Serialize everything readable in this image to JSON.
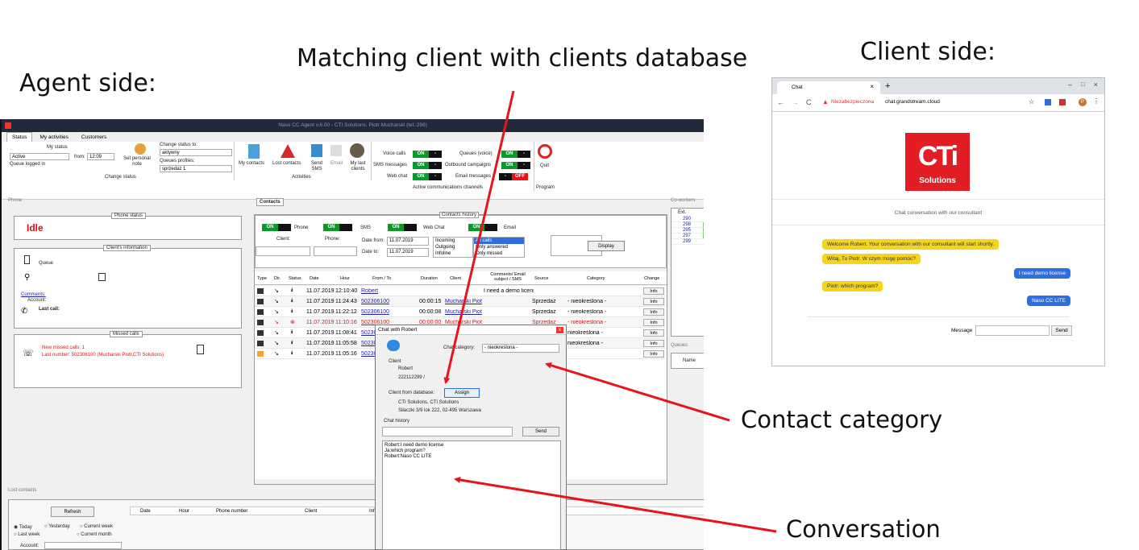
{
  "slide": {
    "agent_side": "Agent side:",
    "client_side": "Client side:",
    "matching": "Matching client with clients database",
    "contact_category": "Contact category",
    "conversation": "Conversation"
  },
  "agent_app": {
    "title": "Naso CC Agent v.6.00 - CTI Solutions, Piotr Mucharski (tel.:298)",
    "tabs": [
      "Status",
      "My activities",
      "Customers"
    ],
    "my_status_label": "My status",
    "status_value": "Active",
    "from_label": "from:",
    "from_value": "12:09",
    "queue_logged": "Queue logged in",
    "set_personal_note": "Set personal note",
    "change_status_to": "Change status to:",
    "status_select": "aktywny",
    "queues_profiles": "Queues profiles:",
    "profile_select": "sprzedaz 1",
    "change_status_group": "Change status",
    "activities": [
      "My contacts",
      "Lost contacts",
      "Send SMS",
      "Email",
      "My last clients"
    ],
    "activities_group": "Activities",
    "channels": [
      {
        "label": "Voice calls",
        "state": "ON"
      },
      {
        "label": "SMS messages",
        "state": "ON"
      },
      {
        "label": "Web chat",
        "state": "ON"
      },
      {
        "label": "Queues (voice)",
        "state": "ON"
      },
      {
        "label": "Outbound campaigns",
        "state": "ON"
      },
      {
        "label": "Email messages",
        "state": "OFF"
      }
    ],
    "on_label": "ON",
    "off_label": "OFF",
    "channels_group": "Active communications channels",
    "quit": "Quit",
    "program_group": "Program",
    "phone_panel": "Phone",
    "phone_status": "Phone status",
    "idle": "Idle",
    "clients_info": "Client's information",
    "queue": "Queue",
    "comments": "Comments:",
    "account": "Account:",
    "last_call": "Last call:",
    "missed_calls": "Missed calls",
    "new_missed": "New missed calls: 1",
    "last_number": "Last number: 502306100 (Mucharski Piotr,CTI Solutions)",
    "contacts_tab": "Contacts",
    "contacts_history": "Contacts history",
    "filter_labels": [
      "Phone",
      "SMS",
      "Web Chat",
      "Email"
    ],
    "client_label": "Client:",
    "phone_label": "Phone:",
    "date_from_label": "Date from:",
    "date_to_label": "Date to:",
    "date_from": "11.07.2019",
    "date_to": "11.07.2019",
    "directions": [
      "Incoming",
      "Outgoing",
      "Infoline"
    ],
    "call_filters": [
      "All calls",
      "Only answered",
      "Only missed"
    ],
    "display": "Display",
    "columns": [
      "Type",
      "Dir.",
      "Status",
      "Date",
      "Hour",
      "From / To",
      "Duration",
      "Client",
      "Comments/ Email subject / SMS",
      "Source",
      "Category",
      "Change"
    ],
    "rows": [
      {
        "date": "11.07.2019",
        "hour": "12:10:40",
        "from": "Robert",
        "duration": "",
        "client": "",
        "comment": "I need a demo license",
        "source": "",
        "category": "",
        "red": false
      },
      {
        "date": "11.07.2019",
        "hour": "11:24:43",
        "from": "502306100",
        "duration": "00:00:15",
        "client": "Mucharski Piot...",
        "comment": "",
        "source": "Sprzedaż",
        "category": "- nieokreślona -",
        "red": false
      },
      {
        "date": "11.07.2019",
        "hour": "11:22:12",
        "from": "502306100",
        "duration": "00:00:08",
        "client": "Mucharski Piot...",
        "comment": "",
        "source": "Sprzedaż",
        "category": "- nieokreślona -",
        "red": false
      },
      {
        "date": "11.07.2019",
        "hour": "11:10:16",
        "from": "502306100",
        "duration": "00:00:00",
        "client": "Mucharski Piot...",
        "comment": "",
        "source": "Sprzedaż",
        "category": "- nieokreślona -",
        "red": true
      },
      {
        "date": "11.07.2019",
        "hour": "11:08:41",
        "from": "5023061",
        "duration": "",
        "client": "",
        "comment": "",
        "source": "",
        "category": "nieokreślona -",
        "red": false
      },
      {
        "date": "11.07.2019",
        "hour": "11:05:58",
        "from": "5023061",
        "duration": "",
        "client": "",
        "comment": "",
        "source": "",
        "category": "nieokreślona -",
        "red": false
      },
      {
        "date": "11.07.2019",
        "hour": "11:05:16",
        "from": "5023061",
        "duration": "",
        "client": "",
        "comment": "",
        "source": "",
        "category": "",
        "red": false
      }
    ],
    "info": "Info",
    "coworkers": "Co-workers",
    "ext_header": "Ext.",
    "exts": [
      "290",
      "298",
      "295",
      "297",
      "299"
    ],
    "queues": "Queues",
    "name_col": "Name",
    "lost_contacts": "Lost contacts",
    "refresh": "Refresh",
    "lost_cols": [
      "Date",
      "Hour",
      "Phone number",
      "Client",
      "Info"
    ],
    "periods": [
      "Today",
      "Yesterday",
      "Current week",
      "Last week",
      "Current month"
    ],
    "account_short": "Account:"
  },
  "chat_dialog": {
    "title": "Chat with Robert",
    "close": "x",
    "chat_category": "Chat category:",
    "category_value": "- nieokreślona -",
    "client_header": "Client",
    "client_name": "Robert",
    "client_phone": "222112299 /",
    "from_db": "Client from database:",
    "assign": "Assign",
    "company": "CTI Solutions, CTI Solutions",
    "address": "Siłaczki 3/9 lok 222, 02-495 Warszawa",
    "history": "Chat history",
    "send": "Send",
    "log": [
      "Robert:I need demo license",
      "Ja:which program?",
      "Robert:Naso CC LITE"
    ]
  },
  "client_browser": {
    "tab_title": "Chat",
    "insecure": "Niezabezpieczona",
    "url": "chat.grandstream.cloud",
    "logo_main": "CTi",
    "logo_sub": "Solutions",
    "subtitle": "Chat conversation with our consultant",
    "messages": [
      {
        "text": "Welcome Robert. Your conversation with our consultant will start shortly.",
        "side": "left"
      },
      {
        "text": "Witaj, Tu Piotr. W czym mogę pomóc?",
        "side": "left"
      },
      {
        "text": "I need demo license",
        "side": "right"
      },
      {
        "text": "Piotr: which program?",
        "side": "left"
      },
      {
        "text": "Naso CC LITE",
        "side": "right"
      }
    ],
    "message_label": "Message",
    "send": "Send",
    "avatar": "P"
  },
  "colors": {
    "arrow": "#e8141b",
    "on": "#0a9a2a",
    "off": "#e11111",
    "bubble_yellow": "#f6d41c",
    "bubble_blue": "#2d6ee0"
  }
}
